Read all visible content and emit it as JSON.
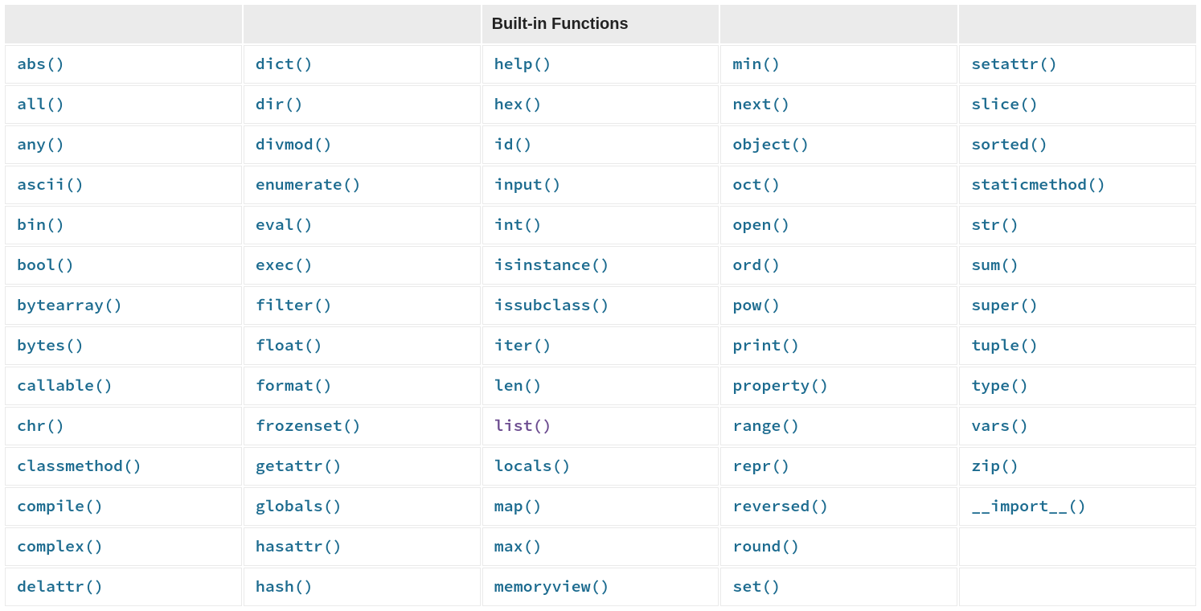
{
  "header_title": "Built-in Functions",
  "link_color": "#1c6b8f",
  "visited_link_color": "#6b4b8f",
  "columns": [
    [
      "abs()",
      "all()",
      "any()",
      "ascii()",
      "bin()",
      "bool()",
      "bytearray()",
      "bytes()",
      "callable()",
      "chr()",
      "classmethod()",
      "compile()",
      "complex()",
      "delattr()"
    ],
    [
      "dict()",
      "dir()",
      "divmod()",
      "enumerate()",
      "eval()",
      "exec()",
      "filter()",
      "float()",
      "format()",
      "frozenset()",
      "getattr()",
      "globals()",
      "hasattr()",
      "hash()"
    ],
    [
      "help()",
      "hex()",
      "id()",
      "input()",
      "int()",
      "isinstance()",
      "issubclass()",
      "iter()",
      "len()",
      "list()",
      "locals()",
      "map()",
      "max()",
      "memoryview()"
    ],
    [
      "min()",
      "next()",
      "object()",
      "oct()",
      "open()",
      "ord()",
      "pow()",
      "print()",
      "property()",
      "range()",
      "repr()",
      "reversed()",
      "round()",
      "set()"
    ],
    [
      "setattr()",
      "slice()",
      "sorted()",
      "staticmethod()",
      "str()",
      "sum()",
      "super()",
      "tuple()",
      "type()",
      "vars()",
      "zip()",
      "__import__()",
      "",
      ""
    ]
  ],
  "visited_links": [
    "list()"
  ]
}
